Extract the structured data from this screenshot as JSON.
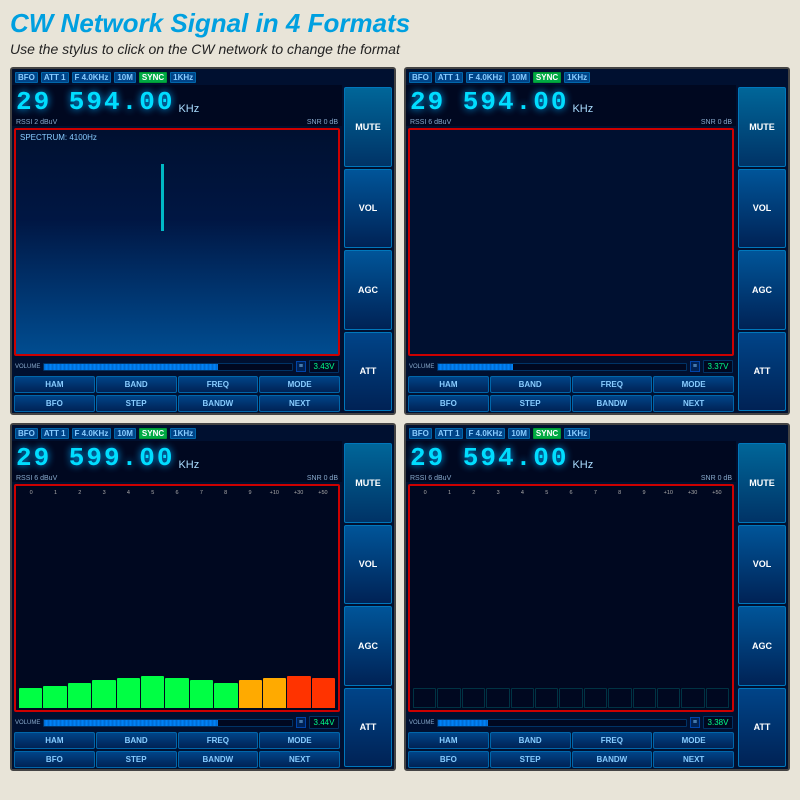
{
  "header": {
    "title": "CW Network Signal in 4 Formats",
    "subtitle": "Use the stylus to click on the CW network to change the format"
  },
  "screens": [
    {
      "id": "screen1",
      "tags": [
        "BFO",
        "ATT 1",
        "F 4.0KHz",
        "10M",
        "SYNC",
        "1KHz"
      ],
      "freq": "29 594.00",
      "unit": "KHz",
      "rssi": "RSSI 2 dBuV",
      "snr": "SNR 0 dB",
      "content_type": "spectrum",
      "spectrum_label": "SPECTRUM: 4100Hz",
      "volume_label": "VOLUME",
      "volume_fill": 70,
      "voltage": "3.43V",
      "buttons_row1": [
        "HAM",
        "BAND",
        "FREQ",
        "MODE"
      ],
      "buttons_row2": [
        "BFO",
        "STEP",
        "BANDW",
        "NEXT"
      ],
      "side_buttons": [
        "MUTE",
        "VOL",
        "AGC",
        "ATT"
      ]
    },
    {
      "id": "screen2",
      "tags": [
        "BFO",
        "ATT 1",
        "F 4.0KHz",
        "10M",
        "SYNC",
        "1KHz"
      ],
      "freq": "29 594.00",
      "unit": "KHz",
      "rssi": "RSSI 6 dBuV",
      "snr": "SNR 0 dB",
      "content_type": "empty",
      "volume_label": "VOLUME",
      "volume_fill": 30,
      "voltage": "3.37V",
      "buttons_row1": [
        "HAM",
        "BAND",
        "FREQ",
        "MODE"
      ],
      "buttons_row2": [
        "BFO",
        "STEP",
        "BANDW",
        "NEXT"
      ],
      "side_buttons": [
        "MUTE",
        "VOL",
        "AGC",
        "ATT"
      ]
    },
    {
      "id": "screen3",
      "tags": [
        "BFO",
        "ATT 1",
        "F 4.0KHz",
        "10M",
        "SYNC",
        "1KHz"
      ],
      "freq": "29 599.00",
      "unit": "KHz",
      "rssi": "RSSI 6 dBuV",
      "snr": "SNR 0 dB",
      "content_type": "smeter_filled",
      "scale_labels": [
        "0",
        "1",
        "2",
        "3",
        "4",
        "5",
        "6",
        "7",
        "8",
        "9",
        "+10",
        "+30",
        "+50"
      ],
      "volume_label": "VOLUME",
      "volume_fill": 70,
      "voltage": "3.44V",
      "buttons_row1": [
        "HAM",
        "BAND",
        "FREQ",
        "MODE"
      ],
      "buttons_row2": [
        "BFO",
        "STEP",
        "BANDW",
        "NEXT"
      ],
      "side_buttons": [
        "MUTE",
        "VOL",
        "AGC",
        "ATT"
      ]
    },
    {
      "id": "screen4",
      "tags": [
        "BFO",
        "ATT 1",
        "F 4.0KHz",
        "10M",
        "SYNC",
        "1KHz"
      ],
      "freq": "29 594.00",
      "unit": "KHz",
      "rssi": "RSSI 6 dBuV",
      "snr": "SNR 0 dB",
      "content_type": "smeter_empty",
      "scale_labels": [
        "0",
        "1",
        "2",
        "3",
        "4",
        "5",
        "6",
        "7",
        "8",
        "9",
        "+10",
        "+30",
        "+50"
      ],
      "volume_label": "VOLUME",
      "volume_fill": 20,
      "voltage": "3.38V",
      "buttons_row1": [
        "HAM",
        "BAND",
        "FREQ",
        "MODE"
      ],
      "buttons_row2": [
        "BFO",
        "STEP",
        "BANDW",
        "NEXT"
      ],
      "side_buttons": [
        "MUTE",
        "VOL",
        "AGC",
        "ATT"
      ]
    }
  ]
}
